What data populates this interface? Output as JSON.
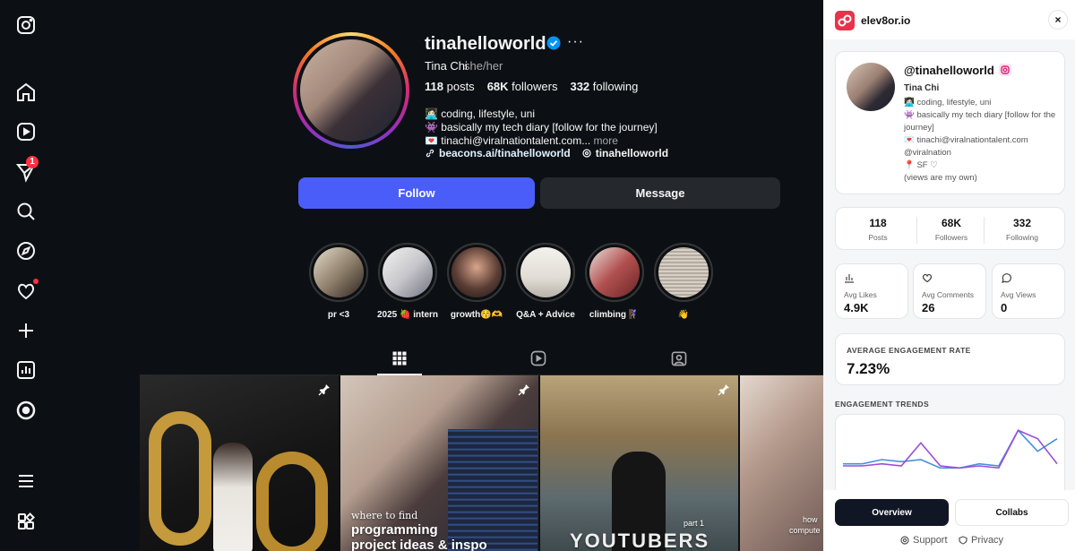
{
  "nav": {
    "icons": [
      "instagram-logo-icon",
      "home-icon",
      "reels-icon",
      "messages-icon",
      "search-icon",
      "explore-icon",
      "notifications-icon",
      "create-icon",
      "dashboard-icon",
      "meta-threads-icon",
      "menu-icon",
      "also-from-meta-icon"
    ],
    "messages_badge": "1"
  },
  "profile": {
    "username": "tinahelloworld",
    "more": "···",
    "name": "Tina Chi",
    "pronouns": "she/her",
    "posts_count": "118",
    "posts_label": "posts",
    "followers_count": "68K",
    "followers_label": "followers",
    "following_count": "332",
    "following_label": "following",
    "bio_line1": "👩🏻‍💻 coding, lifestyle, uni",
    "bio_line2": "👾 basically my tech diary [follow for the journey]",
    "bio_line3": "💌 tinachi@viralnationtalent.com...",
    "bio_more": "more",
    "link": "beacons.ai/tinahelloworld",
    "threads": "tinahelloworld",
    "follow_label": "Follow",
    "message_label": "Message"
  },
  "highlights": [
    {
      "label": "pr <3",
      "color": "#b9a58e"
    },
    {
      "label": "2025 🍓 intern",
      "color": "#d6d6d8"
    },
    {
      "label": "growth😚🫶",
      "color": "#5a3d35"
    },
    {
      "label": "Q&A + Advice",
      "color": "#e9e5e0"
    },
    {
      "label": "climbing 🧗🏻‍♀️",
      "color": "#8e3a3a"
    },
    {
      "label": "👋",
      "color": "#cfc6bb"
    }
  ],
  "posts": [
    {
      "caption": "",
      "pinned": true
    },
    {
      "caption1": "where to find",
      "caption2": "programming",
      "caption3": "project ideas & inspo",
      "pinned": true
    },
    {
      "caption_small": "part 1",
      "caption_big": "YOUTUBERS",
      "pinned": true
    },
    {
      "caption1": "how",
      "caption2": "compute",
      "pinned": false
    }
  ],
  "panel": {
    "brand": "elev8or.io",
    "close": "×",
    "handle": "@tinahelloworld",
    "name": "Tina Chi",
    "bio": [
      "👩🏻‍💻 coding, lifestyle, uni",
      "👾 basically my tech diary [follow for the journey]",
      "💌 tinachi@viralnationtalent.com",
      "@viralnation",
      "📍 SF ♡",
      "(views are my own)"
    ],
    "stats": [
      {
        "value": "118",
        "label": "Posts"
      },
      {
        "value": "68K",
        "label": "Followers"
      },
      {
        "value": "332",
        "label": "Following"
      }
    ],
    "avg_likes_label": "Avg Likes",
    "avg_likes": "4.9K",
    "avg_comments_label": "Avg Comments",
    "avg_comments": "26",
    "avg_views_label": "Avg Views",
    "avg_views": "0",
    "engagement_label": "AVERAGE ENGAGEMENT RATE",
    "engagement_rate": "7.23%",
    "trends_label": "ENGAGEMENT TRENDS",
    "overview_label": "Overview",
    "collabs_label": "Collabs",
    "support_label": "Support",
    "privacy_label": "Privacy",
    "accent": "#e8334b",
    "trend_colors": [
      "#4a90d9",
      "#9b4fd8"
    ]
  },
  "chart_data": {
    "type": "line",
    "title": "ENGAGEMENT TRENDS",
    "x": [
      1,
      2,
      3,
      4,
      5,
      6,
      7,
      8,
      9,
      10,
      11,
      12
    ],
    "series": [
      {
        "values": [
          2,
          2,
          3,
          2.5,
          3,
          1,
          1,
          2,
          1.5,
          10,
          5,
          8
        ]
      },
      {
        "values": [
          1.5,
          1.5,
          2,
          1.5,
          7,
          1.5,
          1,
          1.5,
          1,
          10,
          8,
          2
        ]
      }
    ],
    "ylim": [
      0,
      12
    ],
    "grid": false
  }
}
